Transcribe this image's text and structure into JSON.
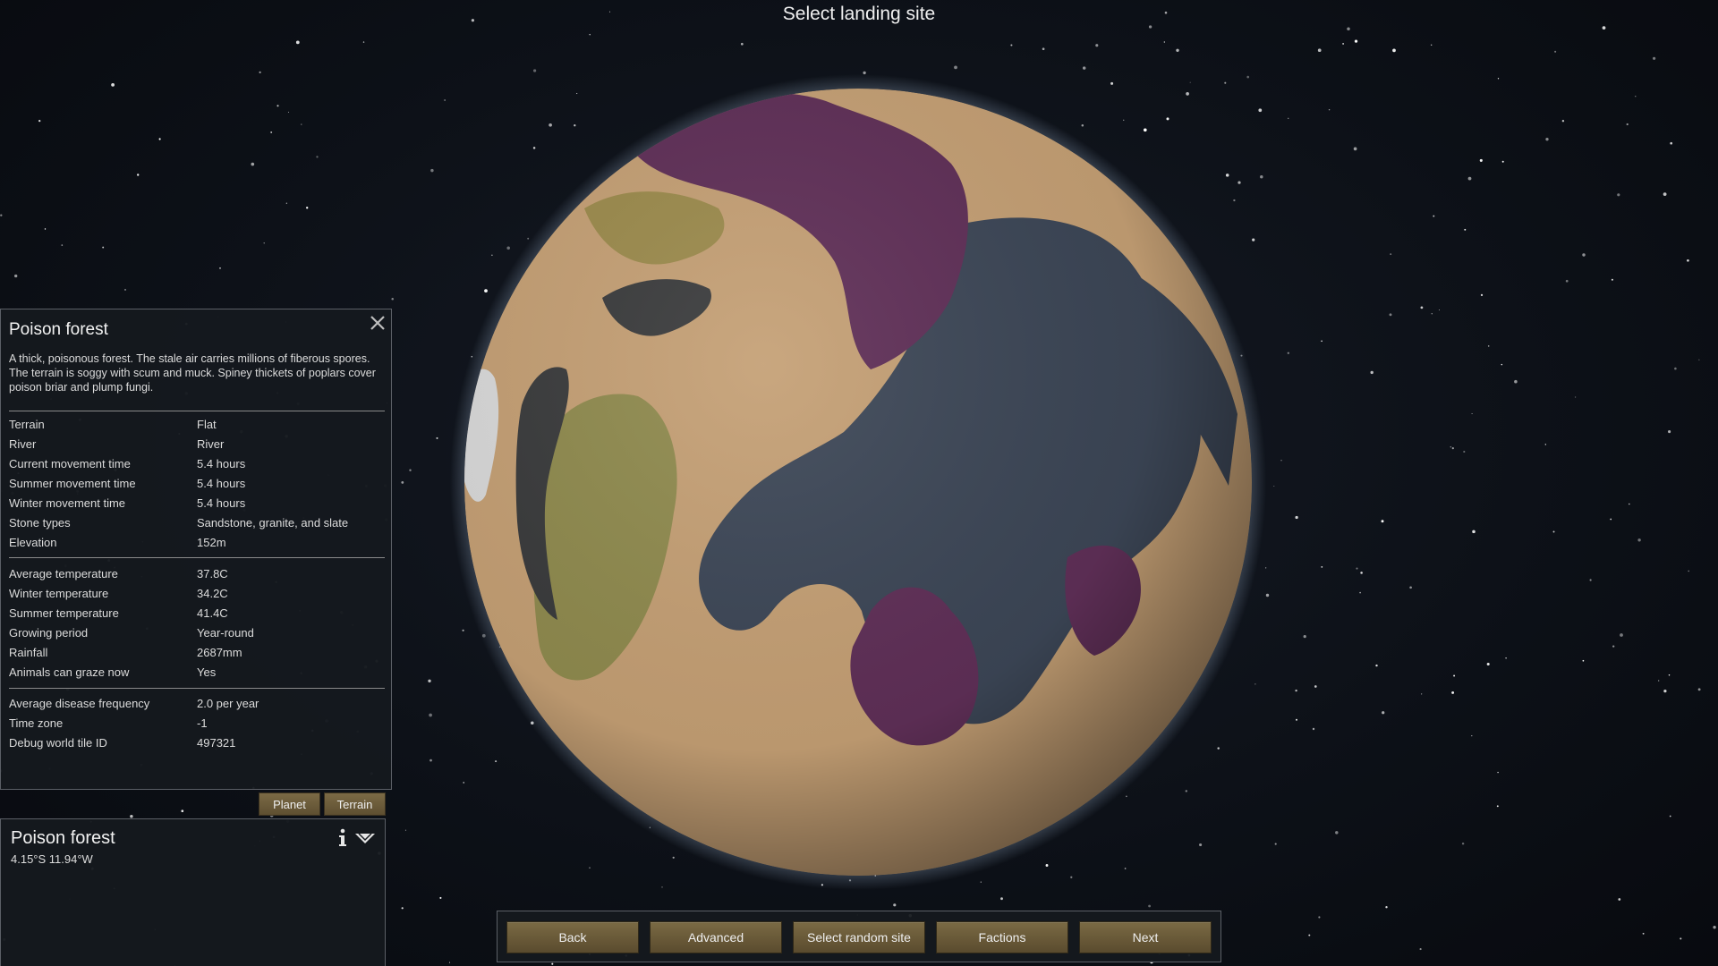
{
  "title": "Select landing site",
  "inspect": {
    "title": "Poison forest",
    "description": "A thick, poisonous forest. The stale air carries millions of fiberous spores. The terrain is soggy with scum and muck. Spiney thickets of poplars cover poison briar and plump fungi.",
    "group1": [
      {
        "label": "Terrain",
        "value": "Flat"
      },
      {
        "label": "River",
        "value": "River"
      },
      {
        "label": "Current movement time",
        "value": "5.4 hours"
      },
      {
        "label": "Summer movement time",
        "value": "5.4 hours"
      },
      {
        "label": "Winter movement time",
        "value": "5.4 hours"
      },
      {
        "label": "Stone types",
        "value": "Sandstone, granite, and slate"
      },
      {
        "label": "Elevation",
        "value": "152m"
      }
    ],
    "group2": [
      {
        "label": "Average temperature",
        "value": "37.8C"
      },
      {
        "label": "Winter temperature",
        "value": "34.2C"
      },
      {
        "label": "Summer temperature",
        "value": "41.4C"
      },
      {
        "label": "Growing period",
        "value": "Year-round"
      },
      {
        "label": "Rainfall",
        "value": "2687mm"
      },
      {
        "label": "Animals can graze now",
        "value": "Yes"
      }
    ],
    "group3": [
      {
        "label": "Average disease frequency",
        "value": "2.0 per year"
      },
      {
        "label": "Time zone",
        "value": "-1"
      },
      {
        "label": "Debug world tile ID",
        "value": "497321"
      }
    ],
    "tabs": {
      "planet": "Planet",
      "terrain": "Terrain"
    }
  },
  "tile": {
    "name": "Poison forest",
    "coords": "4.15°S 11.94°W"
  },
  "bottom_buttons": {
    "back": "Back",
    "advanced": "Advanced",
    "random": "Select random site",
    "factions": "Factions",
    "next": "Next"
  },
  "colors": {
    "button": "#6b5b3b",
    "panel": "#15191e",
    "ocean": "#3c4656",
    "desert": "#c49f74",
    "poison": "#5f2f57",
    "grassland": "#8f8a4e",
    "tundra": "#9c8f82"
  },
  "icons": [
    "close-icon",
    "info-icon",
    "dropdown-icon"
  ]
}
